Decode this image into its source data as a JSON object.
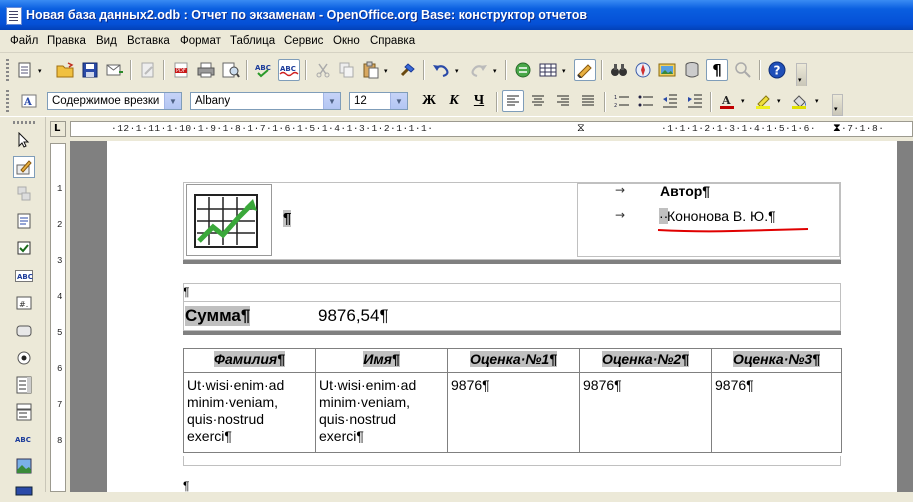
{
  "window": {
    "title": "Новая база данных2.odb : Отчет по экзаменам - OpenOffice.org Base: конструктор отчетов"
  },
  "menu": [
    "Файл",
    "Правка",
    "Вид",
    "Вставка",
    "Формат",
    "Таблица",
    "Сервис",
    "Окно",
    "Справка"
  ],
  "toolbar_format": {
    "style": "Содержимое врезки",
    "font": "Albany",
    "size": "12",
    "bold_glyph": "Ж",
    "italic_glyph": "К",
    "underline_glyph": "Ч"
  },
  "ruler": {
    "left_numbers": "·12·1·11·1·10·1·9·1·8·1·7·1·6·1·5·1·4·1·3·1·2·1·1·1·",
    "right_numbers": "·1·1·1·2·1·3·1·4·1·5·1·6·",
    "right_tail": "·7·1·8·",
    "vertical": [
      "1",
      "2",
      "3",
      "4",
      "5",
      "6",
      "7",
      "8"
    ]
  },
  "report": {
    "header_pilcrow": "¶",
    "author_label": "Автор¶",
    "author_value": "Кононова В. Ю.¶",
    "author_lead": "··",
    "empty_para": "¶",
    "sum_label": "Сумма¶",
    "sum_value": "9876,54¶",
    "table_headers": [
      "Фамилия¶",
      "Имя¶",
      "Оценка·№1¶",
      "Оценка·№2¶",
      "Оценка·№3¶"
    ],
    "table_row": [
      "Ut·wisi·enim·ad minim·veniam, quis·nostrud exerci¶",
      "Ut·wisi·enim·ad minim·veniam, quis·nostrud exerci¶",
      "9876¶",
      "9876¶",
      "9876¶"
    ],
    "footer_pilcrow": "¶"
  },
  "colors": {
    "titlebar": "#0550d6",
    "shade": "#c0c0c0",
    "workspace": "#808080",
    "underline": "#e00000"
  }
}
